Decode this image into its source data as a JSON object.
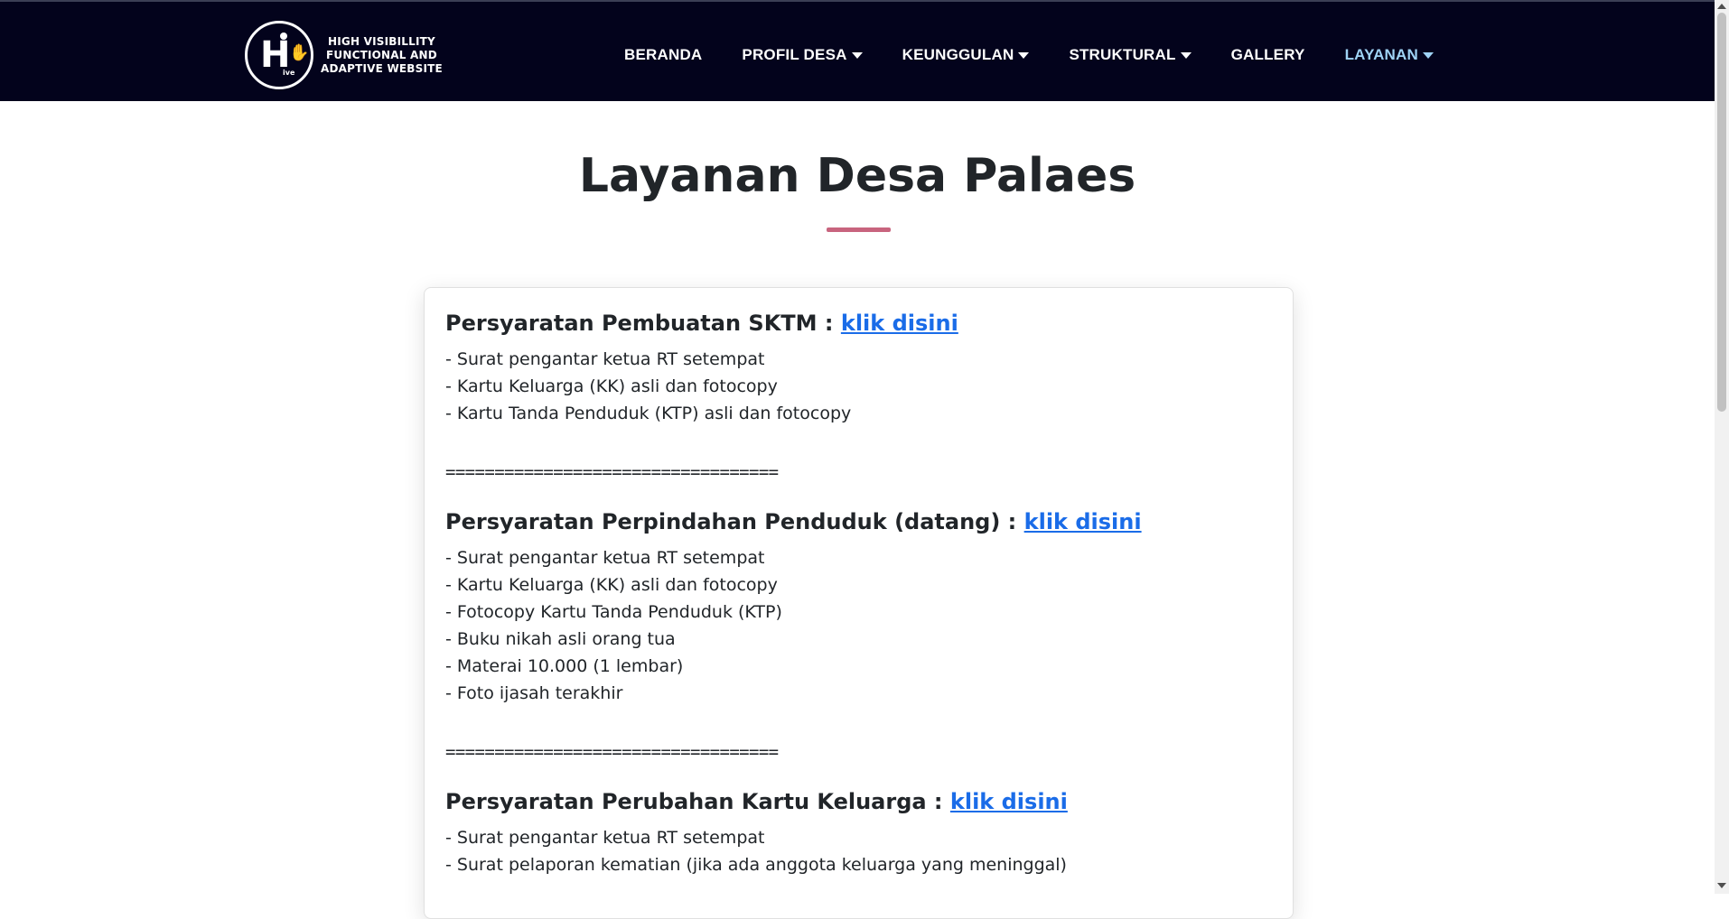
{
  "brand": {
    "logo_mark": "HIve",
    "line1": "HIGH VISIBILLITY",
    "line2": "FUNCTIONAL AND",
    "line3": "ADAPTIVE WEBSITE"
  },
  "nav": {
    "items": [
      {
        "label": "BERANDA",
        "dropdown": false,
        "active": false
      },
      {
        "label": "PROFIL DESA",
        "dropdown": true,
        "active": false
      },
      {
        "label": "KEUNGGULAN",
        "dropdown": true,
        "active": false
      },
      {
        "label": "STRUKTURAL",
        "dropdown": true,
        "active": false
      },
      {
        "label": "GALLERY",
        "dropdown": false,
        "active": false
      },
      {
        "label": "LAYANAN",
        "dropdown": true,
        "active": true
      }
    ]
  },
  "page": {
    "title": "Layanan Desa Palaes"
  },
  "sections": [
    {
      "title": "Persyaratan Pembuatan SKTM : ",
      "link": "klik disini",
      "items": [
        "- Surat pengantar ketua RT setempat",
        "- Kartu Keluarga (KK) asli dan fotocopy",
        "- Kartu Tanda Penduduk (KTP) asli dan fotocopy"
      ]
    },
    {
      "title": "Persyaratan Perpindahan Penduduk (datang) : ",
      "link": "klik disini",
      "items": [
        "- Surat pengantar ketua RT setempat",
        "- Kartu Keluarga (KK) asli dan fotocopy",
        "- Fotocopy Kartu Tanda Penduduk (KTP)",
        "- Buku nikah asli orang tua",
        "- Materai 10.000 (1 lembar)",
        "- Foto ijasah terakhir"
      ]
    },
    {
      "title": "Persyaratan Perubahan Kartu Keluarga : ",
      "link": "klik disini",
      "items": [
        "- Surat pengantar ketua RT setempat",
        "- Surat pelaporan kematian (jika ada anggota keluarga yang meninggal)"
      ]
    }
  ],
  "divider_text": "==================================",
  "colors": {
    "navbar_bg": "#03031c",
    "active_nav": "#9fd3f5",
    "link": "#1a6ce8",
    "title_underline": "#c8647e"
  }
}
